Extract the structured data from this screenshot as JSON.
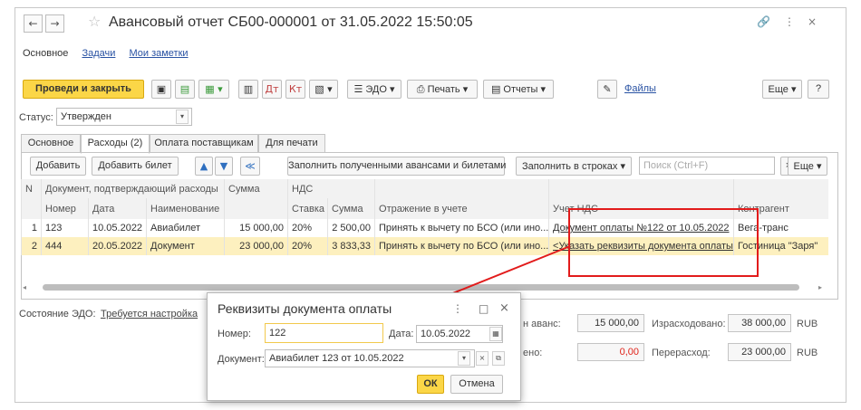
{
  "window": {
    "title": "Авансовый отчет СБ00-000001 от 31.05.2022 15:50:05",
    "back": "←",
    "forward": "→",
    "star": "☆",
    "link_icon": "🔗",
    "more": "⋮",
    "close": "×"
  },
  "section_tabs": [
    "Основное",
    "Задачи",
    "Мои заметки"
  ],
  "toolbar": {
    "post_close": "Проведи и закрыть",
    "edo": "ЭДО",
    "print": "Печать",
    "reports": "Отчеты",
    "files": "Файлы",
    "more": "Еще",
    "help": "?"
  },
  "status": {
    "label": "Статус:",
    "value": "Утвержден"
  },
  "tabs": [
    "Основное",
    "Расходы (2)",
    "Оплата поставщикам",
    "Для печати"
  ],
  "grid_toolbar": {
    "add": "Добавить",
    "add_ticket": "Добавить билет",
    "fill_advances": "Заполнить полученными авансами и билетами",
    "fill_rows": "Заполнить в строках",
    "search_placeholder": "Поиск (Ctrl+F)",
    "clear": "×",
    "more": "Еще"
  },
  "table": {
    "header1": {
      "n": "N",
      "doc": "Документ, подтверждающий расходы",
      "sum": "Сумма",
      "vat": "НДС"
    },
    "header2": {
      "number": "Номер",
      "date": "Дата",
      "name": "Наименование",
      "rate": "Ставка",
      "vat_sum": "Сумма",
      "accounting": "Отражение в учете",
      "vat_account": "Учет НДС",
      "counterparty": "Контрагент"
    },
    "rows": [
      {
        "n": "1",
        "number": "123",
        "date": "10.05.2022",
        "name": "Авиабилет",
        "sum": "15 000,00",
        "rate": "20%",
        "vat_sum": "2 500,00",
        "accounting": "Принять к вычету по БСО (или ино...",
        "vat_account": "Документ оплаты №122 от 10.05.2022",
        "counterparty": "Вега-транс"
      },
      {
        "n": "2",
        "number": "444",
        "date": "20.05.2022",
        "name": "Документ",
        "sum": "23 000,00",
        "rate": "20%",
        "vat_sum": "3 833,33",
        "accounting": "Принять к вычету по БСО (или ино...",
        "vat_account": "<Указать реквизиты документа оплаты>",
        "counterparty": "Гостиница \"Заря\""
      }
    ]
  },
  "edo_state": {
    "label": "Состояние ЭДО:",
    "value": "Требуется настройка"
  },
  "totals": {
    "received_label": "н аванс:",
    "received": "15 000,00",
    "spent_label": "Израсходовано:",
    "spent": "38 000,00",
    "currency1": "RUB",
    "rest_label": "ено:",
    "rest": "0,00",
    "overspent_label": "Перерасход:",
    "overspent": "23 000,00",
    "currency2": "RUB"
  },
  "dialog": {
    "title": "Реквизиты документа оплаты",
    "more": "⋮",
    "maximize": "□",
    "close": "×",
    "number_label": "Номер:",
    "number_value": "122",
    "date_label": "Дата:",
    "date_value": "10.05.2022",
    "document_label": "Документ:",
    "document_value": "Авиабилет 123 от 10.05.2022",
    "ok": "ОК",
    "cancel": "Отмена"
  },
  "colors": {
    "primary_button": "#fbd647",
    "selected_row": "#fdf0bf",
    "link": "#2952a3",
    "highlight_red": "#e21b1b",
    "active_input_border": "#f2c94c"
  }
}
